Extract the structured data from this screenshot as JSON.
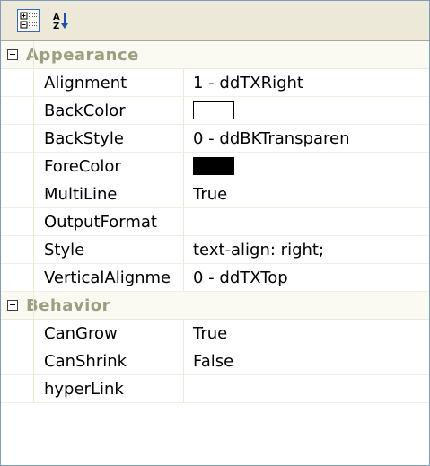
{
  "toolbar": {
    "categorized_icon": "categorized-icon",
    "alphabetical_icon": "alphabetical-sort-icon"
  },
  "categories": [
    {
      "label": "Appearance",
      "properties": [
        {
          "name": "Alignment",
          "value": "1 - ddTXRight"
        },
        {
          "name": "BackColor",
          "value": "",
          "swatch": "#ffffff"
        },
        {
          "name": "BackStyle",
          "value": "0 - ddBKTransparen"
        },
        {
          "name": "ForeColor",
          "value": "",
          "swatch": "#000000"
        },
        {
          "name": "MultiLine",
          "value": "True"
        },
        {
          "name": "OutputFormat",
          "value": ""
        },
        {
          "name": "Style",
          "value": "text-align: right;"
        },
        {
          "name": "VerticalAlignme",
          "value": "0 - ddTXTop"
        }
      ]
    },
    {
      "label": "Behavior",
      "properties": [
        {
          "name": "CanGrow",
          "value": "True"
        },
        {
          "name": "CanShrink",
          "value": "False"
        },
        {
          "name": "hyperLink",
          "value": ""
        }
      ]
    }
  ],
  "colors": {
    "category_text": "#9e9e80",
    "toolbar_bg": "#ece9d8",
    "selection_border": "#316ac5"
  }
}
